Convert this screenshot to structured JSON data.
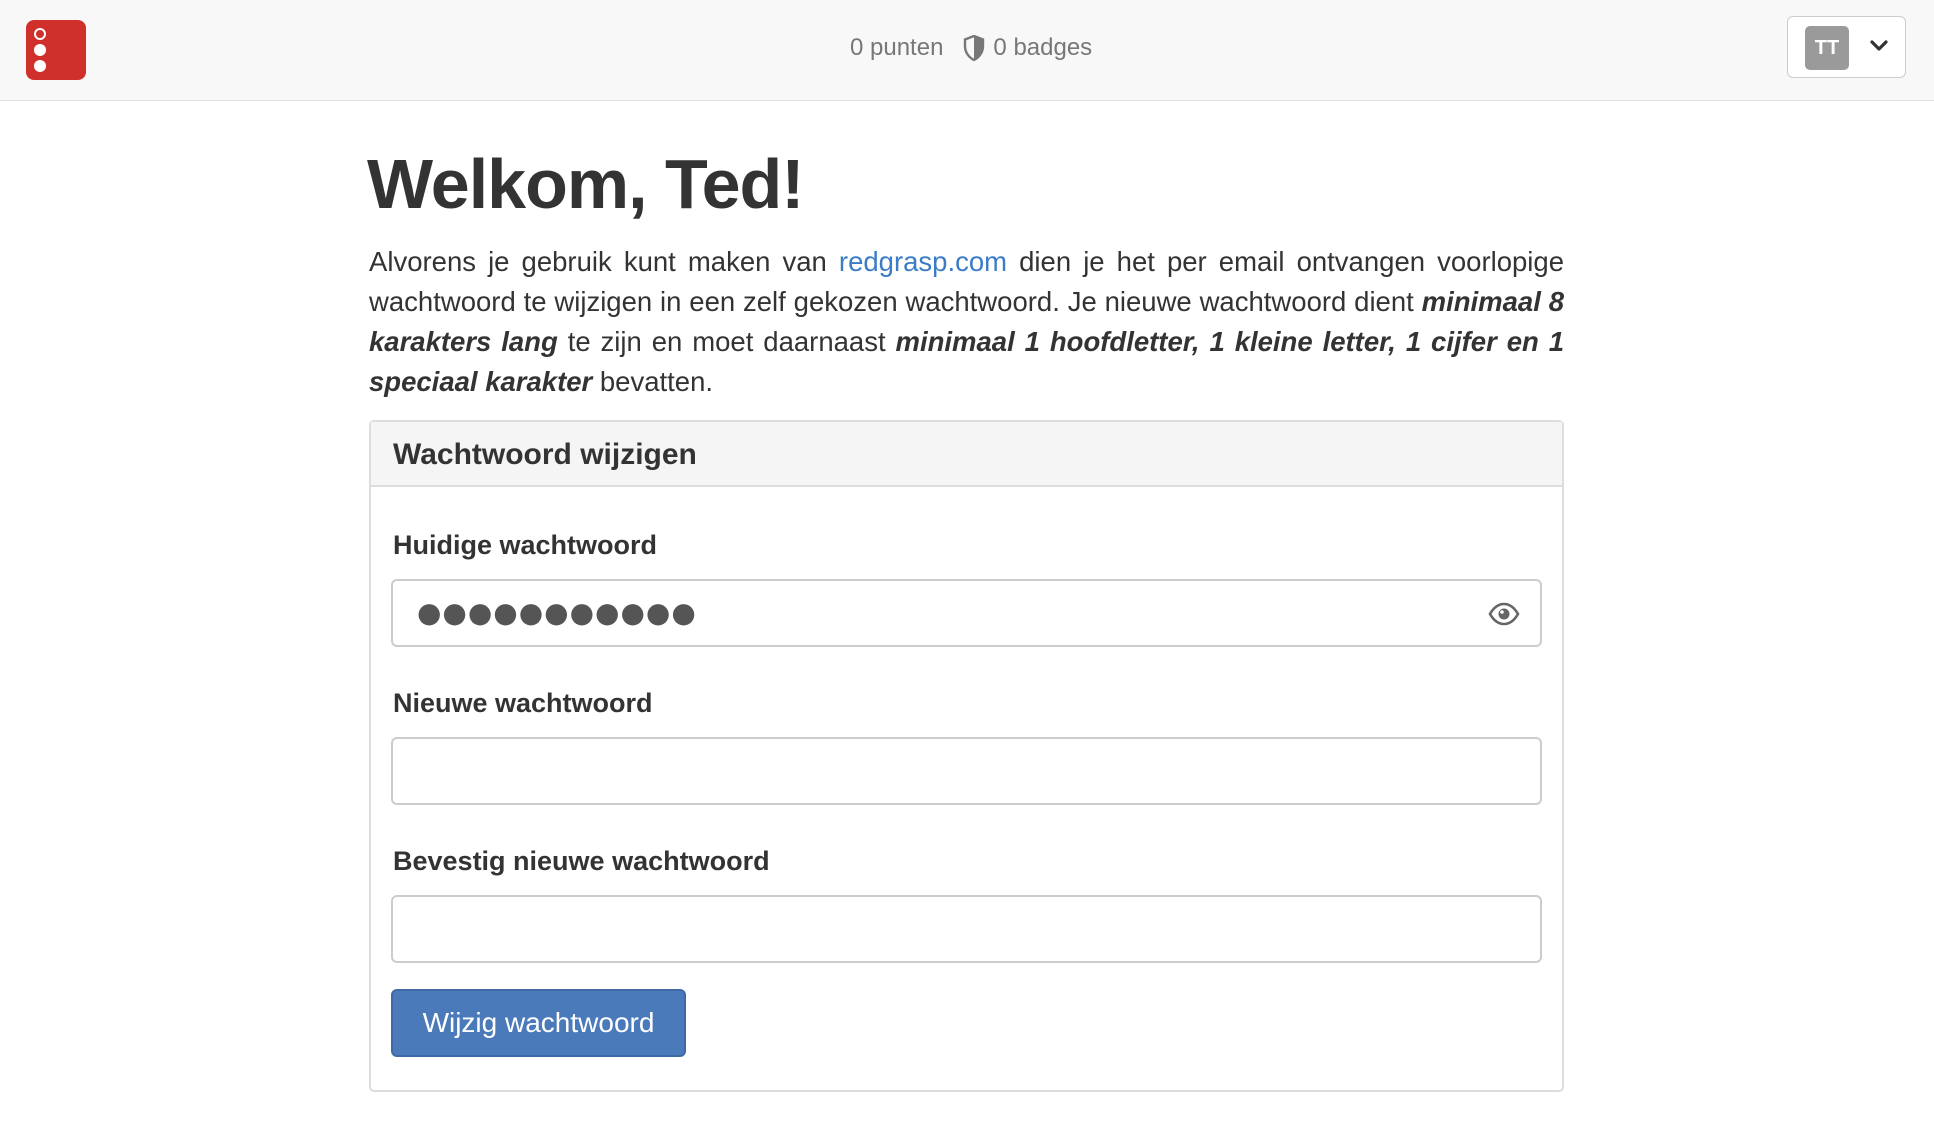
{
  "navbar": {
    "logo_color": "#d0302b",
    "points": "0 punten",
    "badges": "0 badges",
    "badge_icon": "shield-icon",
    "user_initials": "TT",
    "user_menu_icon": "chevron-down-icon"
  },
  "main": {
    "title": "Welkom, Ted!",
    "intro": {
      "part1": "Alvorens je gebruik kunt maken van ",
      "link": "redgrasp.com",
      "part2": " dien je het per email ontvangen voorlopige wachtwoord te wijzigen in een zelf gekozen wachtwoord. Je nieuwe wachtwoord dient ",
      "emphasis1": "minimaal 8 karakters lang",
      "part3": " te zijn en moet daarnaast ",
      "emphasis2": "minimaal 1 hoofdletter, 1 kleine letter, 1 cijfer en 1 speciaal karakter",
      "part4": " bevatten."
    }
  },
  "form": {
    "heading": "Wachtwoord wijzigen",
    "current_label": "Huidige wachtwoord",
    "current_value": "●●●●●●●●●●●",
    "show_password_icon": "eye-icon",
    "new_label": "Nieuwe wachtwoord",
    "new_value": "",
    "confirm_label": "Bevestig nieuwe wachtwoord",
    "confirm_value": "",
    "submit_label": "Wijzig wachtwoord",
    "accent_color": "#4a7ab9"
  }
}
